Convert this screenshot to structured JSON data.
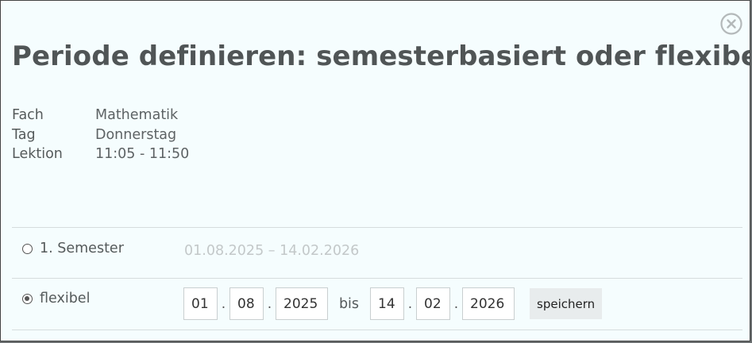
{
  "dialog": {
    "title": "Periode definieren: semesterbasiert oder flexibel",
    "close_icon": "close-circle-icon"
  },
  "info": [
    {
      "label": "Fach",
      "value": "Mathematik"
    },
    {
      "label": "Tag",
      "value": "Donnerstag"
    },
    {
      "label": "Lektion",
      "value": "11:05 - 11:50"
    }
  ],
  "options": {
    "semester": {
      "label": "1. Semester",
      "range": "01.08.2025 – 14.02.2026",
      "checked": false
    },
    "flexible": {
      "label": "flexibel",
      "checked": true,
      "from": {
        "day": "01",
        "month": "08",
        "year": "2025"
      },
      "separator": "bis",
      "to": {
        "day": "14",
        "month": "02",
        "year": "2026"
      },
      "date_dot": ".",
      "save_label": "speichern"
    }
  }
}
